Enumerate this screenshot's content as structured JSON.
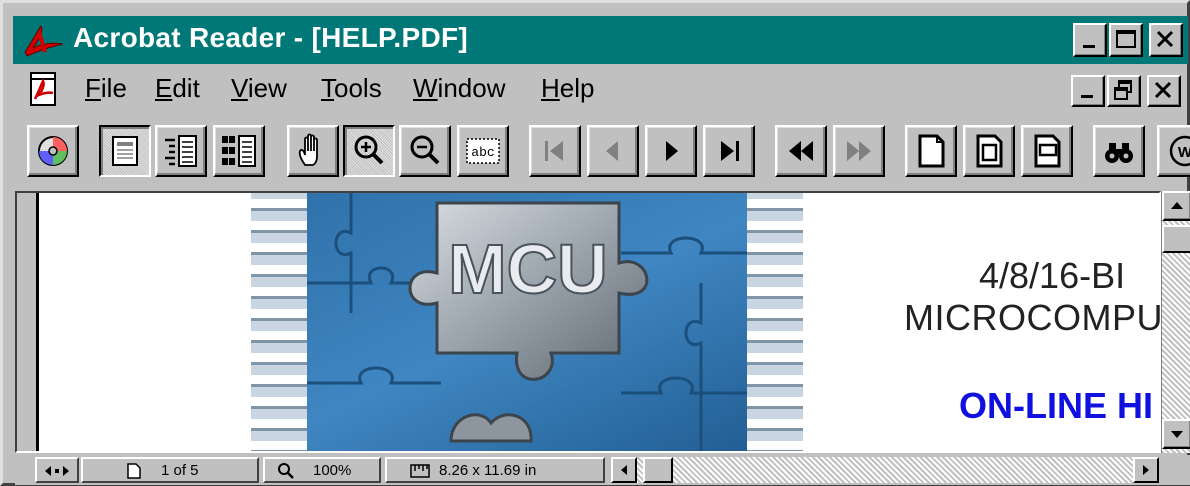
{
  "window": {
    "title": "Acrobat Reader - [HELP.PDF]",
    "title_bar_color": "#007878"
  },
  "menubar": {
    "items": [
      {
        "label": "File",
        "mnemonic": "F"
      },
      {
        "label": "Edit",
        "mnemonic": "E"
      },
      {
        "label": "View",
        "mnemonic": "V"
      },
      {
        "label": "Tools",
        "mnemonic": "T"
      },
      {
        "label": "Window",
        "mnemonic": "W"
      },
      {
        "label": "Help",
        "mnemonic": "H"
      }
    ]
  },
  "toolbar": {
    "buttons": [
      "open-cd-icon",
      "page-only-icon",
      "bookmarks-and-page-icon",
      "thumbnails-and-page-icon",
      "hand-tool-icon",
      "zoom-in-icon",
      "zoom-out-icon",
      "text-select-icon",
      "first-page-icon",
      "previous-page-icon",
      "next-page-icon",
      "last-page-icon",
      "go-back-icon",
      "go-forward-icon",
      "actual-size-icon",
      "fit-page-icon",
      "fit-width-icon",
      "find-icon",
      "web-link-icon"
    ]
  },
  "document": {
    "cover_image_text": "MCU",
    "line1": "4/8/16-BI",
    "line2": "MICROCOMPU",
    "line3": "ON-LINE HI",
    "accent_color": "#1010e0"
  },
  "statusbar": {
    "page": "1 of 5",
    "zoom": "100%",
    "page_size": "8.26 x 11.69 in"
  }
}
